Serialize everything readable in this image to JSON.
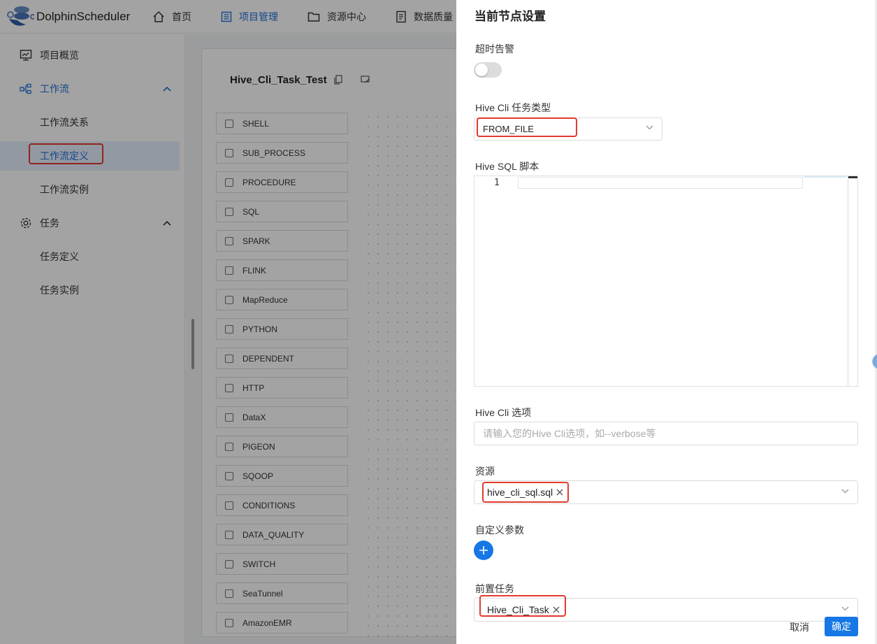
{
  "header": {
    "app_name": "DolphinScheduler",
    "nav": [
      {
        "label": "首页",
        "icon": "home-icon"
      },
      {
        "label": "项目管理",
        "icon": "project-icon"
      },
      {
        "label": "资源中心",
        "icon": "folder-icon"
      },
      {
        "label": "数据质量",
        "icon": "data-quality-icon"
      }
    ]
  },
  "sidebar": {
    "items": [
      {
        "label": "项目概览",
        "icon": "overview-icon"
      },
      {
        "label": "工作流",
        "icon": "workflow-icon"
      },
      {
        "label": "工作流关系"
      },
      {
        "label": "工作流定义"
      },
      {
        "label": "工作流实例"
      },
      {
        "label": "任务",
        "icon": "gear-icon"
      },
      {
        "label": "任务定义"
      },
      {
        "label": "任务实例"
      }
    ]
  },
  "workflow": {
    "title": "Hive_Cli_Task_Test",
    "tasks": [
      "SHELL",
      "SUB_PROCESS",
      "PROCEDURE",
      "SQL",
      "SPARK",
      "FLINK",
      "MapReduce",
      "PYTHON",
      "DEPENDENT",
      "HTTP",
      "DataX",
      "PIGEON",
      "SQOOP",
      "CONDITIONS",
      "DATA_QUALITY",
      "SWITCH",
      "SeaTunnel",
      "AmazonEMR"
    ]
  },
  "drawer": {
    "title": "当前节点设置",
    "timeout_label": "超时告警",
    "timeout_enabled": false,
    "task_type_label": "Hive Cli 任务类型",
    "task_type_value": "FROM_FILE",
    "script_label": "Hive SQL 脚本",
    "line_number": "1",
    "options_label": "Hive Cli 选项",
    "options_placeholder": "请输入您的Hive Cli选项，如--verbose等",
    "resource_label": "资源",
    "resource_tag": "hive_cli_sql.sql",
    "custom_params_label": "自定义参数",
    "pre_task_label": "前置任务",
    "pre_task_tag": "Hive_Cli_Task",
    "cancel_label": "取消",
    "confirm_label": "确定"
  },
  "colors": {
    "accent": "#1677e5",
    "highlight": "#e23b2e"
  }
}
